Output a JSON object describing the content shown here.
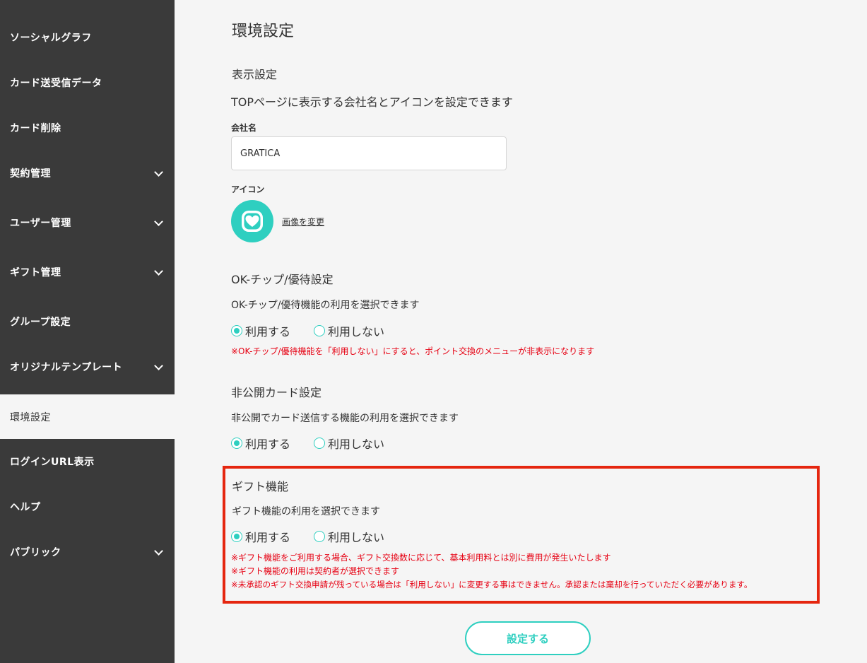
{
  "sidebar": {
    "items": [
      {
        "label": "ソーシャルグラフ",
        "expandable": false
      },
      {
        "label": "カード送受信データ",
        "expandable": false
      },
      {
        "label": "カード削除",
        "expandable": false
      },
      {
        "label": "契約管理",
        "expandable": true
      },
      {
        "label": "ユーザー管理",
        "expandable": true
      },
      {
        "label": "ギフト管理",
        "expandable": true
      },
      {
        "label": "グループ設定",
        "expandable": false
      },
      {
        "label": "オリジナルテンプレート",
        "expandable": true
      },
      {
        "label": "環境設定",
        "expandable": false,
        "active": true
      },
      {
        "label": "ログインURL表示",
        "expandable": false
      },
      {
        "label": "ヘルプ",
        "expandable": false
      },
      {
        "label": "パブリック",
        "expandable": true
      }
    ]
  },
  "page": {
    "title": "環境設定"
  },
  "display_settings": {
    "title": "表示設定",
    "description": "TOPページに表示する会社名とアイコンを設定できます",
    "company_label": "会社名",
    "company_value": "GRATICA",
    "icon_label": "アイコン",
    "change_image_link": "画像を変更"
  },
  "ok_chip": {
    "title": "OK-チップ/優待設定",
    "description": "OK-チップ/優待機能の利用を選択できます",
    "option_use": "利用する",
    "option_not_use": "利用しない",
    "selected": "use",
    "note": "※OK-チップ/優待機能を「利用しない」にすると、ポイント交換のメニューが非表示になります"
  },
  "private_card": {
    "title": "非公開カード設定",
    "description": "非公開でカード送信する機能の利用を選択できます",
    "option_use": "利用する",
    "option_not_use": "利用しない",
    "selected": "use"
  },
  "gift": {
    "title": "ギフト機能",
    "description": "ギフト機能の利用を選択できます",
    "option_use": "利用する",
    "option_not_use": "利用しない",
    "selected": "use",
    "notes": [
      "※ギフト機能をご利用する場合、ギフト交換数に応じて、基本利用料とは別に費用が発生いたします",
      "※ギフト機能の利用は契約者が選択できます",
      "※未承認のギフト交換申請が残っている場合は「利用しない」に変更する事はできません。承認または棄却を行っていただく必要があります。"
    ]
  },
  "submit_button": "設定する",
  "colors": {
    "sidebar_bg": "#3a3a3a",
    "accent": "#2ecfc0",
    "warning": "#e60012",
    "highlight_border": "#e5260f"
  }
}
